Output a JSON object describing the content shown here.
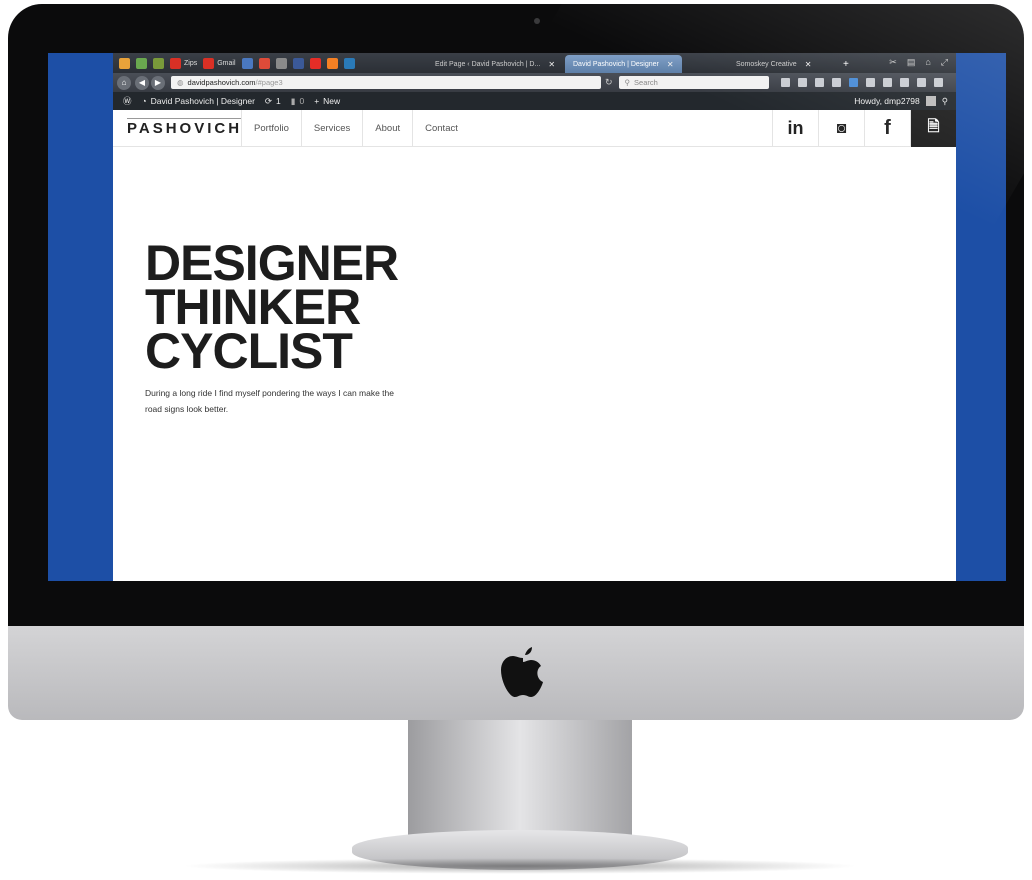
{
  "browser": {
    "bookmarks": [
      {
        "label": "",
        "color": "#e8a23a"
      },
      {
        "label": "",
        "color": "#6aa84f"
      },
      {
        "label": "",
        "color": "#7a9a3a"
      },
      {
        "label": "Zips",
        "color": "#d93025"
      },
      {
        "label": "Gmail",
        "color": "#d93025"
      },
      {
        "label": "",
        "color": "#4a78c0"
      },
      {
        "label": "",
        "color": "#dd4b39"
      },
      {
        "label": "",
        "color": "#8a8a8a"
      },
      {
        "label": "",
        "color": "#3b5998"
      },
      {
        "label": "",
        "color": "#e52d27"
      },
      {
        "label": "",
        "color": "#f48024"
      },
      {
        "label": "",
        "color": "#2a7ab8"
      }
    ],
    "tabs": [
      {
        "title": "Edit Page ‹ David Pashovich | D...",
        "close": "✕",
        "active": false
      },
      {
        "title": "David Pashovich | Designer",
        "close": "✕",
        "active": true
      },
      {
        "title": "Somoskey Creative",
        "close": "✕",
        "active": false
      }
    ],
    "new_tab": "+",
    "url_domain": "davidpashovich.com",
    "url_path": "/#page3",
    "search_placeholder": "Search"
  },
  "wp_admin_bar": {
    "site_name": "David Pashovich | Designer",
    "updates_count": "1",
    "comments_count": "0",
    "new_label": "New",
    "howdy": "Howdy, dmp2798"
  },
  "site": {
    "logo": "PASHOVICH",
    "menu": [
      "Portfolio",
      "Services",
      "About",
      "Contact"
    ],
    "social": [
      {
        "icon": "linkedin-icon",
        "glyph": "in"
      },
      {
        "icon": "instagram-icon",
        "glyph": "◙"
      },
      {
        "icon": "facebook-icon",
        "glyph": "f"
      },
      {
        "icon": "document-icon",
        "glyph": "🗎"
      }
    ],
    "headline": [
      "DESIGNER",
      "THINKER",
      "CYCLIST"
    ],
    "tagline": "During a long ride I find myself pondering the ways I can make the road signs look better."
  },
  "colors": {
    "desktop": "#1d4fa6",
    "admin_bar": "#23282d",
    "headline": "#1d1d1d"
  }
}
